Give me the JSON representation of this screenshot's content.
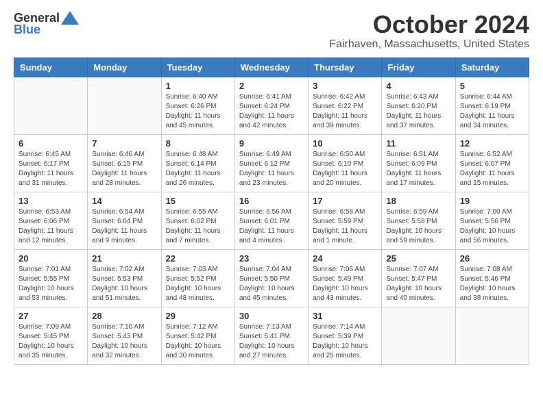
{
  "logo": {
    "general": "General",
    "blue": "Blue"
  },
  "title": "October 2024",
  "subtitle": "Fairhaven, Massachusetts, United States",
  "weekdays": [
    "Sunday",
    "Monday",
    "Tuesday",
    "Wednesday",
    "Thursday",
    "Friday",
    "Saturday"
  ],
  "weeks": [
    [
      {
        "day": "",
        "info": ""
      },
      {
        "day": "",
        "info": ""
      },
      {
        "day": "1",
        "info": "Sunrise: 6:40 AM\nSunset: 6:26 PM\nDaylight: 11 hours and 45 minutes."
      },
      {
        "day": "2",
        "info": "Sunrise: 6:41 AM\nSunset: 6:24 PM\nDaylight: 11 hours and 42 minutes."
      },
      {
        "day": "3",
        "info": "Sunrise: 6:42 AM\nSunset: 6:22 PM\nDaylight: 11 hours and 39 minutes."
      },
      {
        "day": "4",
        "info": "Sunrise: 6:43 AM\nSunset: 6:20 PM\nDaylight: 11 hours and 37 minutes."
      },
      {
        "day": "5",
        "info": "Sunrise: 6:44 AM\nSunset: 6:19 PM\nDaylight: 11 hours and 34 minutes."
      }
    ],
    [
      {
        "day": "6",
        "info": "Sunrise: 6:45 AM\nSunset: 6:17 PM\nDaylight: 11 hours and 31 minutes."
      },
      {
        "day": "7",
        "info": "Sunrise: 6:46 AM\nSunset: 6:15 PM\nDaylight: 11 hours and 28 minutes."
      },
      {
        "day": "8",
        "info": "Sunrise: 6:48 AM\nSunset: 6:14 PM\nDaylight: 11 hours and 26 minutes."
      },
      {
        "day": "9",
        "info": "Sunrise: 6:49 AM\nSunset: 6:12 PM\nDaylight: 11 hours and 23 minutes."
      },
      {
        "day": "10",
        "info": "Sunrise: 6:50 AM\nSunset: 6:10 PM\nDaylight: 11 hours and 20 minutes."
      },
      {
        "day": "11",
        "info": "Sunrise: 6:51 AM\nSunset: 6:09 PM\nDaylight: 11 hours and 17 minutes."
      },
      {
        "day": "12",
        "info": "Sunrise: 6:52 AM\nSunset: 6:07 PM\nDaylight: 11 hours and 15 minutes."
      }
    ],
    [
      {
        "day": "13",
        "info": "Sunrise: 6:53 AM\nSunset: 6:06 PM\nDaylight: 11 hours and 12 minutes."
      },
      {
        "day": "14",
        "info": "Sunrise: 6:54 AM\nSunset: 6:04 PM\nDaylight: 11 hours and 9 minutes."
      },
      {
        "day": "15",
        "info": "Sunrise: 6:55 AM\nSunset: 6:02 PM\nDaylight: 11 hours and 7 minutes."
      },
      {
        "day": "16",
        "info": "Sunrise: 6:56 AM\nSunset: 6:01 PM\nDaylight: 11 hours and 4 minutes."
      },
      {
        "day": "17",
        "info": "Sunrise: 6:58 AM\nSunset: 5:59 PM\nDaylight: 11 hours and 1 minute."
      },
      {
        "day": "18",
        "info": "Sunrise: 6:59 AM\nSunset: 5:58 PM\nDaylight: 10 hours and 59 minutes."
      },
      {
        "day": "19",
        "info": "Sunrise: 7:00 AM\nSunset: 5:56 PM\nDaylight: 10 hours and 56 minutes."
      }
    ],
    [
      {
        "day": "20",
        "info": "Sunrise: 7:01 AM\nSunset: 5:55 PM\nDaylight: 10 hours and 53 minutes."
      },
      {
        "day": "21",
        "info": "Sunrise: 7:02 AM\nSunset: 5:53 PM\nDaylight: 10 hours and 51 minutes."
      },
      {
        "day": "22",
        "info": "Sunrise: 7:03 AM\nSunset: 5:52 PM\nDaylight: 10 hours and 48 minutes."
      },
      {
        "day": "23",
        "info": "Sunrise: 7:04 AM\nSunset: 5:50 PM\nDaylight: 10 hours and 45 minutes."
      },
      {
        "day": "24",
        "info": "Sunrise: 7:06 AM\nSunset: 5:49 PM\nDaylight: 10 hours and 43 minutes."
      },
      {
        "day": "25",
        "info": "Sunrise: 7:07 AM\nSunset: 5:47 PM\nDaylight: 10 hours and 40 minutes."
      },
      {
        "day": "26",
        "info": "Sunrise: 7:08 AM\nSunset: 5:46 PM\nDaylight: 10 hours and 38 minutes."
      }
    ],
    [
      {
        "day": "27",
        "info": "Sunrise: 7:09 AM\nSunset: 5:45 PM\nDaylight: 10 hours and 35 minutes."
      },
      {
        "day": "28",
        "info": "Sunrise: 7:10 AM\nSunset: 5:43 PM\nDaylight: 10 hours and 32 minutes."
      },
      {
        "day": "29",
        "info": "Sunrise: 7:12 AM\nSunset: 5:42 PM\nDaylight: 10 hours and 30 minutes."
      },
      {
        "day": "30",
        "info": "Sunrise: 7:13 AM\nSunset: 5:41 PM\nDaylight: 10 hours and 27 minutes."
      },
      {
        "day": "31",
        "info": "Sunrise: 7:14 AM\nSunset: 5:39 PM\nDaylight: 10 hours and 25 minutes."
      },
      {
        "day": "",
        "info": ""
      },
      {
        "day": "",
        "info": ""
      }
    ]
  ]
}
